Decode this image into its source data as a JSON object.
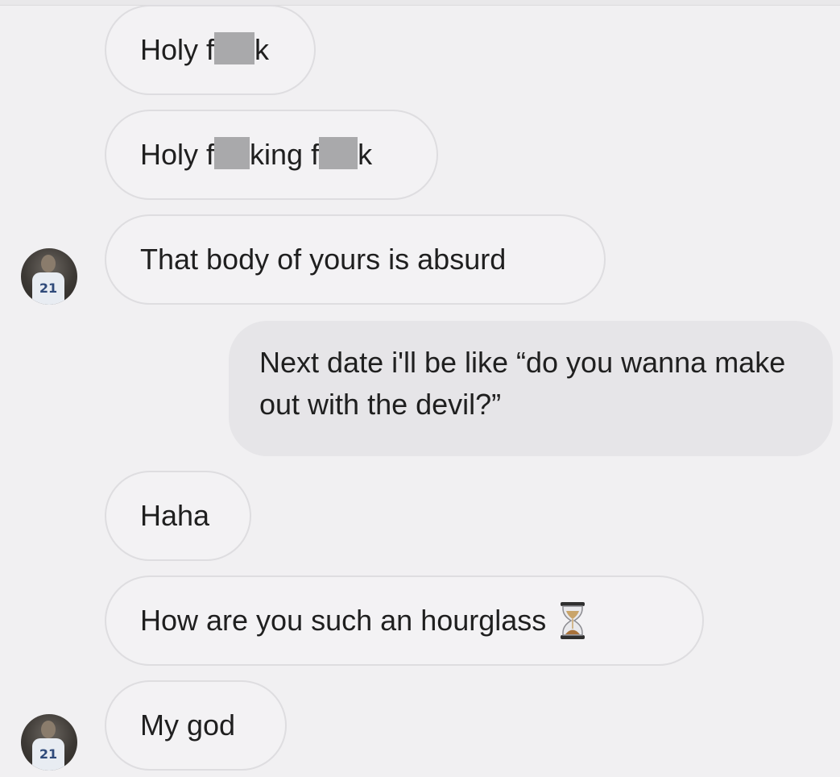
{
  "messages": [
    {
      "direction": "incoming",
      "parts": [
        "Holy f",
        "k"
      ]
    },
    {
      "direction": "incoming",
      "parts": [
        "Holy f",
        "king f",
        "k"
      ]
    },
    {
      "direction": "incoming",
      "text": "That body of yours is absurd"
    },
    {
      "direction": "outgoing",
      "text": "Next date i'll be like “do you wanna make out with the devil?”"
    },
    {
      "direction": "incoming",
      "text": "Haha"
    },
    {
      "direction": "incoming",
      "text": "How are you such an hourglass",
      "emoji": "hourglass-icon"
    },
    {
      "direction": "incoming",
      "text": "My god"
    }
  ],
  "avatar": {
    "jersey_number": "21"
  },
  "colors": {
    "background": "#f1f0f2",
    "incoming_bubble": "#f3f2f4",
    "incoming_border": "#dedde0",
    "outgoing_bubble": "#e6e5e8",
    "censor_block": "#a9a9ab"
  }
}
